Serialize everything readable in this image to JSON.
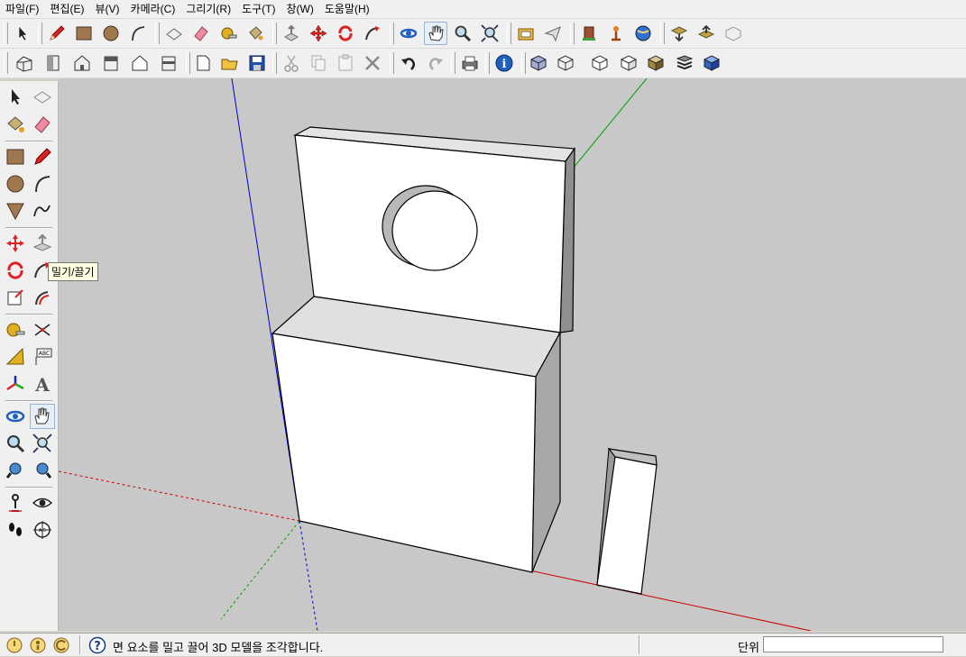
{
  "menubar": {
    "items": [
      "파일(F)",
      "편집(E)",
      "뷰(V)",
      "카메라(C)",
      "그리기(R)",
      "도구(T)",
      "창(W)",
      "도움말(H)"
    ]
  },
  "tooltip": {
    "text": "밀기/끌기"
  },
  "statusbar": {
    "message": "면 요소를 밀고 끌어 3D 모델을 조각합니다.",
    "units_label": "단위",
    "units_value": ""
  },
  "colors": {
    "viewport_bg": "#c8c8c8",
    "axis_red": "#cc0000",
    "axis_green": "#00a000",
    "axis_blue": "#0000cc"
  }
}
